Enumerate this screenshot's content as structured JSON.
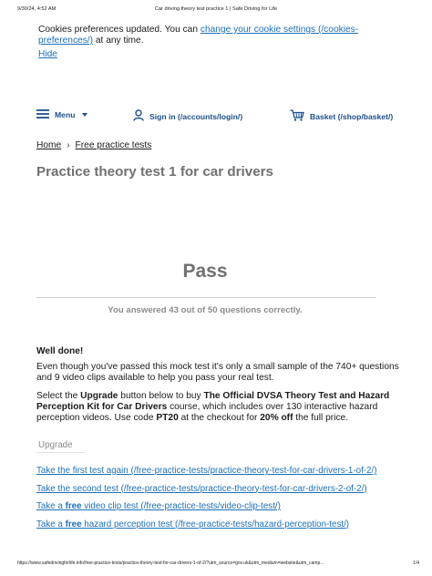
{
  "print_header": {
    "timestamp": "9/30/24, 4:52 AM",
    "title": "Car driving theory test practice 1 | Safe Driving for Life"
  },
  "cookie_banner": {
    "text_before": "Cookies preferences updated. You can ",
    "link_text": "change your cookie settings (/cookies-preferences/)",
    "text_after": " at any time.",
    "hide_label": "Hide"
  },
  "nav": {
    "menu_label": "Menu",
    "signin_label": "Sign in",
    "signin_href_text": "(/accounts/login/)",
    "basket_label": "Basket",
    "basket_href_text": "(/shop/basket/)"
  },
  "breadcrumb": {
    "home": "Home",
    "separator": "›",
    "current": "Free practice tests"
  },
  "page_title": "Practice theory test 1 for car drivers",
  "result": {
    "status": "Pass",
    "summary": "You answered 43 out of 50 questions correctly."
  },
  "content": {
    "heading": "Well done!",
    "paragraph1": "Even though you've passed this mock test it's only a small sample of the 740+ questions and 9 video clips available to help you pass your real test.",
    "para2_a": "Select the ",
    "para2_upgrade": "Upgrade",
    "para2_b": " button below to buy ",
    "para2_course": "The Official DVSA Theory Test and Hazard Perception Kit for Car Drivers",
    "para2_c": " course, which includes over 130 interactive hazard perception videos. Use code ",
    "para2_code": "PT20",
    "para2_d": " at the checkout for ",
    "para2_discount": "20% off",
    "para2_e": " the full price.",
    "upgrade_button": "Upgrade"
  },
  "links": {
    "first_test": "Take the first test again (/free-practice-tests/practice-theory-test-for-car-drivers-1-of-2/)",
    "second_test": "Take the second test (/free-practice-tests/practice-theory-test-for-car-drivers-2-of-2/)",
    "video_pre": "Take a ",
    "video_free": "free",
    "video_post": " video clip test (/free-practice-tests/video-clip-test/)",
    "hazard_pre": "Take a ",
    "hazard_free": "free",
    "hazard_post": " hazard perception test (/free-practice-tests/hazard-perception-test/)"
  },
  "print_footer": {
    "url": "https://www.safedrivingforlife.info/free-practice-tests/practice-theory-test-for-car-drivers-1-of-2/?utm_source=gov.uk&utm_medium=website&utm_camp...",
    "page": "1/4"
  },
  "colors": {
    "link": "#1d70b8",
    "nav": "#1d4f8c",
    "muted_heading": "#707070"
  },
  "icons": {
    "menu": "hamburger-icon",
    "signin": "user-icon",
    "basket": "basket-icon",
    "menu_dropdown": "caret-down-icon",
    "breadcrumb_separator": "chevron-right-icon"
  }
}
